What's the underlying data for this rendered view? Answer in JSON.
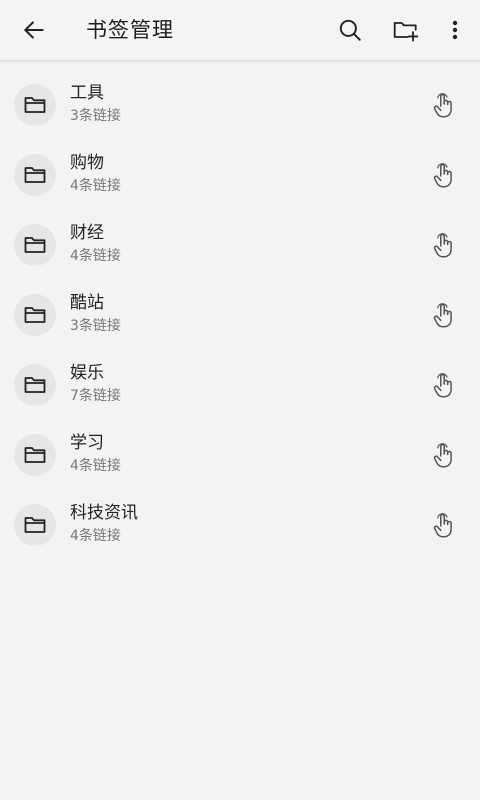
{
  "header": {
    "title": "书签管理",
    "icons": [
      "arrow-left-icon",
      "search-icon",
      "folder-add-icon",
      "more-vertical-icon"
    ]
  },
  "folders": [
    {
      "name": "工具",
      "count_label": "3条链接"
    },
    {
      "name": "购物",
      "count_label": "4条链接"
    },
    {
      "name": "财经",
      "count_label": "4条链接"
    },
    {
      "name": "酷站",
      "count_label": "3条链接"
    },
    {
      "name": "娱乐",
      "count_label": "7条链接"
    },
    {
      "name": "学习",
      "count_label": "4条链接"
    },
    {
      "name": "科技资讯",
      "count_label": "4条链接"
    }
  ],
  "colors": {
    "background": "#f3f3f3",
    "icon_circle": "#e6e6e6",
    "primary_text": "#222222",
    "secondary_text": "#777777"
  }
}
